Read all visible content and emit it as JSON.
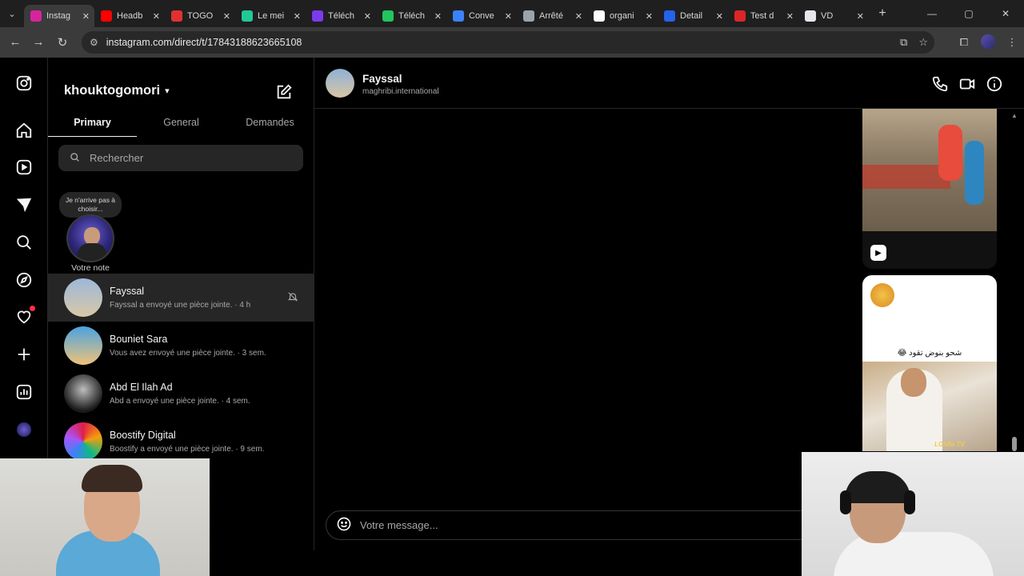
{
  "browser": {
    "tabs": [
      {
        "label": "Instag",
        "color": "#d6249f"
      },
      {
        "label": "Headb",
        "color": "#ff0000"
      },
      {
        "label": "TOGO",
        "color": "#e03131"
      },
      {
        "label": "Le mei",
        "color": "#20c997"
      },
      {
        "label": "Téléch",
        "color": "#7c3aed"
      },
      {
        "label": "Téléch",
        "color": "#22c55e"
      },
      {
        "label": "Conve",
        "color": "#3b82f6"
      },
      {
        "label": "Arrêté",
        "color": "#9ca3af"
      },
      {
        "label": "organi",
        "color": "#ffffff"
      },
      {
        "label": "Detail",
        "color": "#2563eb"
      },
      {
        "label": "Test d",
        "color": "#dc2626"
      },
      {
        "label": "VD",
        "color": "#e5e7eb"
      }
    ],
    "url": "instagram.com/direct/t/17843188623665108"
  },
  "inbox": {
    "account": "khouktogomori",
    "tabs": [
      "Primary",
      "General",
      "Demandes"
    ],
    "search_placeholder": "Rechercher",
    "note_text": "Je n'arrive pas à choisir...",
    "note_label": "Votre note",
    "conversations": [
      {
        "name": "Fayssal",
        "preview": "Fayssal a envoyé une pièce jointe. · 4 h",
        "bg": "linear-gradient(180deg,#9db8d9,#d8c8a8)"
      },
      {
        "name": "Bouniet Sara",
        "preview": "Vous avez envoyé une pièce jointe. · 3 sem.",
        "bg": "linear-gradient(180deg,#4aa3df,#f0c27b)"
      },
      {
        "name": "Abd El Ilah Ad",
        "preview": "Abd a envoyé une pièce jointe. · 4 sem.",
        "bg": "radial-gradient(circle at 50% 40%,#bdbdbd,#1a1a1a 70%)"
      },
      {
        "name": "Boostify Digital",
        "preview": "Boostify a envoyé une pièce jointe. · 9 sem.",
        "bg": "conic-gradient(#e11d48,#f59e0b,#10b981,#3b82f6,#a855f7,#e11d48)"
      }
    ]
  },
  "thread": {
    "name": "Fayssal",
    "username": "maghribi.international",
    "media_caption": "شحو بنوض تقود 😂",
    "watermark": "LGhfla TV",
    "message_placeholder": "Votre message..."
  }
}
